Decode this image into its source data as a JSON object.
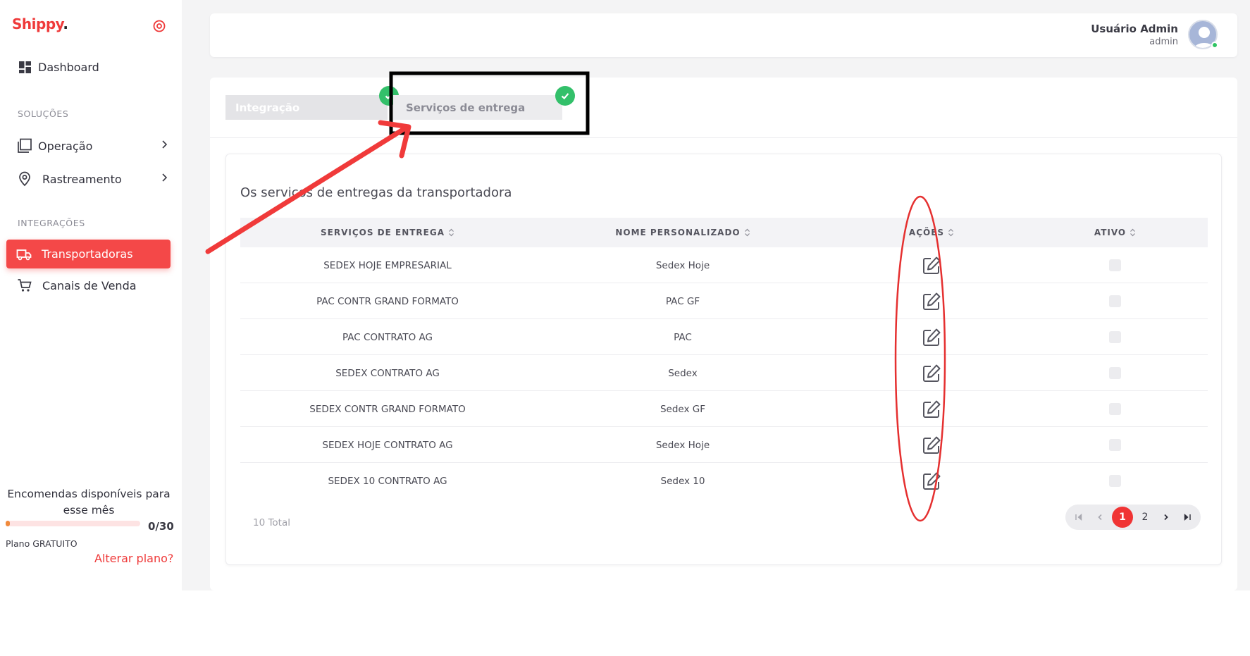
{
  "brand": {
    "name": "Shippy",
    "dot": "."
  },
  "sidebar": {
    "dashboard": "Dashboard",
    "sections": {
      "solutions": "SOLUÇÕES",
      "integrations": "INTEGRAÇÕES"
    },
    "items": {
      "operation": "Operação",
      "tracking": "Rastreamento",
      "carriers": "Transportadoras",
      "sales_channels": "Canais de Venda"
    },
    "quota": {
      "text": "Encomendas disponíveis para esse mês",
      "count": "0/30",
      "progress": 0
    },
    "plan": "Plano GRATUITO",
    "change_plan": "Alterar plano?"
  },
  "header": {
    "user_name": "Usuário Admin",
    "user_role": "admin"
  },
  "steps": [
    {
      "label": "Integração",
      "done": true
    },
    {
      "label": "Serviços de entrega",
      "done": true
    }
  ],
  "card": {
    "title": "Os serviços de entregas da transportadora",
    "columns": [
      "SERVIÇOS DE ENTREGA",
      "NOME PERSONALIZADO",
      "AÇÕES",
      "ATIVO"
    ],
    "rows": [
      {
        "service": "SEDEX HOJE EMPRESARIAL",
        "custom": "Sedex Hoje",
        "active": false
      },
      {
        "service": "PAC CONTR GRAND FORMATO",
        "custom": "PAC GF",
        "active": false
      },
      {
        "service": "PAC CONTRATO AG",
        "custom": "PAC",
        "active": false
      },
      {
        "service": "SEDEX CONTRATO AG",
        "custom": "Sedex",
        "active": false
      },
      {
        "service": "SEDEX CONTR GRAND FORMATO",
        "custom": "Sedex GF",
        "active": false
      },
      {
        "service": "SEDEX HOJE CONTRATO AG",
        "custom": "Sedex Hoje",
        "active": false
      },
      {
        "service": "SEDEX 10 CONTRATO AG",
        "custom": "Sedex 10",
        "active": false
      }
    ],
    "total": "10 Total",
    "pagination": {
      "pages": [
        "1",
        "2"
      ],
      "current": "1"
    }
  },
  "colors": {
    "accent": "#f44848",
    "success": "#33c06a",
    "annotation": "#f03a3a"
  }
}
